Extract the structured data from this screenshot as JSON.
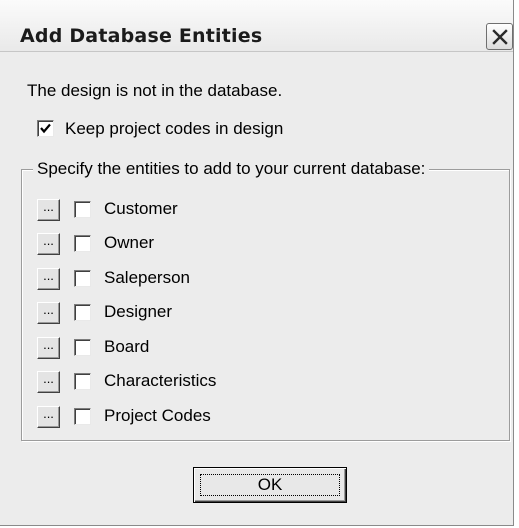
{
  "dialog": {
    "title": "Add Database Entities",
    "message": "The design is not in the database.",
    "keep_codes": {
      "label": "Keep project codes in design",
      "checked": true
    },
    "group_label": "Specify the entities to add to your current database:",
    "browse_label": "...",
    "entities": [
      {
        "label": "Customer",
        "checked": false
      },
      {
        "label": "Owner",
        "checked": false
      },
      {
        "label": "Saleperson",
        "checked": false
      },
      {
        "label": "Designer",
        "checked": false
      },
      {
        "label": "Board",
        "checked": false
      },
      {
        "label": "Characteristics",
        "checked": false
      },
      {
        "label": "Project Codes",
        "checked": false
      }
    ],
    "ok_label": "OK"
  },
  "icons": {
    "close": "close-icon",
    "check": "checkmark-icon"
  }
}
